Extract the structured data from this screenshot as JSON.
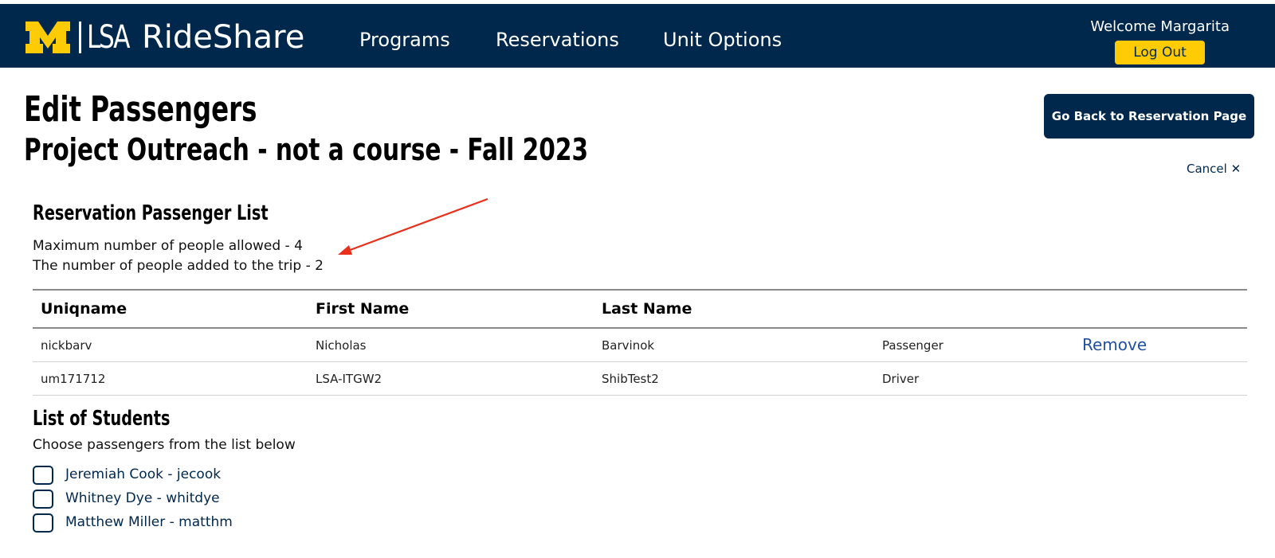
{
  "header": {
    "logo_mark": "M",
    "logo_text": "LSA",
    "brand": "RideShare",
    "nav": [
      "Programs",
      "Reservations",
      "Unit Options"
    ],
    "welcome": "Welcome Margarita",
    "logout_label": "Log Out",
    "colors": {
      "navy": "#00274c",
      "maize": "#ffcb05"
    }
  },
  "page": {
    "title": "Edit Passengers",
    "subtitle": "Project Outreach - not a course - Fall 2023",
    "go_back_label": "Go Back to Reservation Page",
    "cancel_label": "Cancel ✕"
  },
  "passenger_list": {
    "heading": "Reservation Passenger List",
    "max_text": "Maximum number of people allowed - 4",
    "added_text": "The number of people added to the trip - 2",
    "columns": [
      "Uniqname",
      "First Name",
      "Last Name"
    ],
    "rows": [
      {
        "uniqname": "nickbarv",
        "first": "Nicholas",
        "last": "Barvinok",
        "role": "Passenger",
        "action": "Remove"
      },
      {
        "uniqname": "um171712",
        "first": "LSA-ITGW2",
        "last": "ShibTest2",
        "role": "Driver",
        "action": ""
      }
    ]
  },
  "students": {
    "heading": "List of Students",
    "instructions": "Choose passengers from the list below",
    "items": [
      {
        "label": "Jeremiah Cook - jecook",
        "checked": false
      },
      {
        "label": "Whitney Dye - whitdye",
        "checked": false
      },
      {
        "label": "Matthew Miller - matthm",
        "checked": false
      }
    ]
  },
  "annotation": {
    "arrow_color": "#e8301c"
  }
}
